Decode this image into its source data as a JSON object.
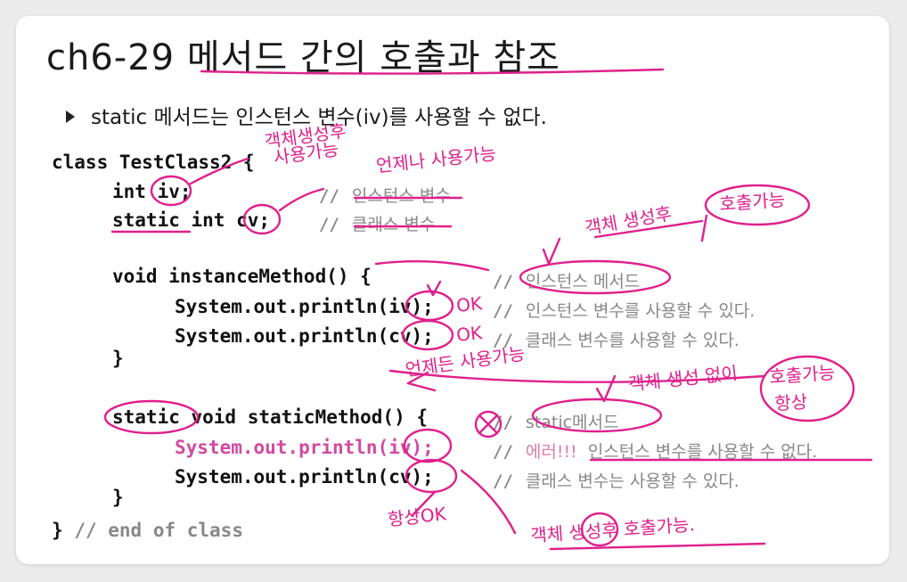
{
  "title": "ch6-29 메서드 간의 호출과 참조",
  "bullet": "static 메서드는 인스턴스 변수(iv)를 사용할 수 없다.",
  "code": {
    "line1": "class TestClass2 {",
    "line2": "int iv;",
    "line3_kw": "static",
    "line3": " int cv;",
    "line4": "void instanceMethod() {",
    "line5": "System.out.println(iv);",
    "line6": "System.out.println(cv);",
    "line7": "}",
    "line8_kw": "static",
    "line8": " void staticMethod() {",
    "line9": "System.out.println(iv);",
    "line10": "System.out.println(cv);",
    "line11": "}",
    "line12": "}",
    "line12_comment": "// end of class"
  },
  "comments": {
    "c_iv": "인스턴스 변수",
    "c_cv": "클래스 변수",
    "c_im": "인스턴스 메서드",
    "c_im_iv": "인스턴스 변수를 사용할 수 있다.",
    "c_im_cv": "클래스 변수를 사용할 수 있다.",
    "c_sm": "static메서드",
    "c_sm_iv_err": "에러!!!",
    "c_sm_iv": "인스턴스 변수를 사용할 수 없다.",
    "c_sm_cv": "클래스 변수는 사용할 수 있다."
  },
  "handwriting": {
    "h1": "객체생성후",
    "h2": "사용가능",
    "h3": "언제나 사용가능",
    "h4": "객체 생성후",
    "h5": "호출가능",
    "h6": "OK",
    "h7": "OK",
    "h8": "언제든 사용가능",
    "h9": "객체 생성 없이",
    "h10": "호출가능",
    "h11": "항상",
    "h12": "항상OK",
    "h13": "객체 생성후 호출가능."
  },
  "colors": {
    "ink": "#e0208c",
    "comment": "#888888",
    "error_code": "#d24aa0",
    "error_text": "#e07aa8"
  }
}
